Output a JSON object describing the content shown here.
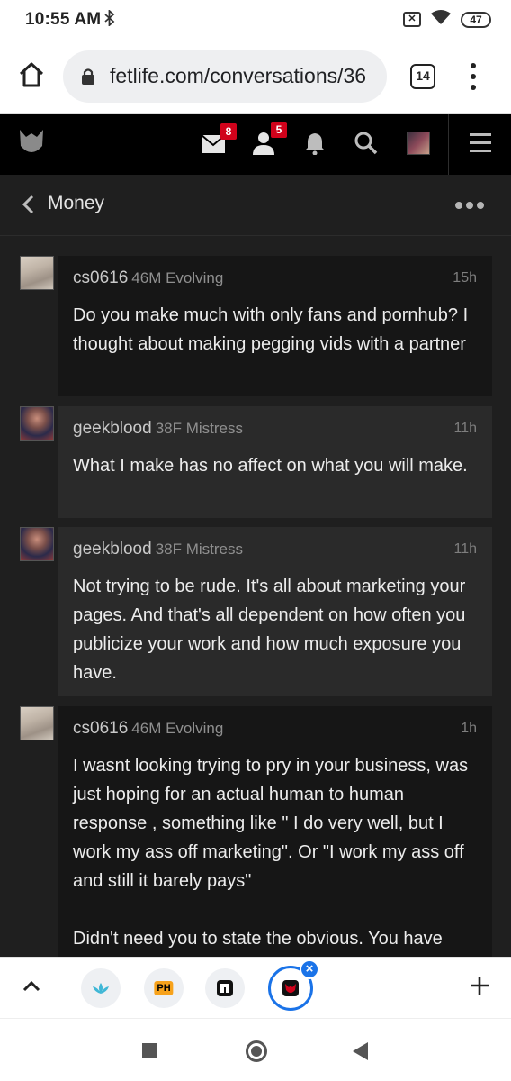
{
  "status_bar": {
    "time": "10:55 AM",
    "battery": "47"
  },
  "browser": {
    "url": "fetlife.com/conversations/36",
    "tab_count": "14"
  },
  "site_nav": {
    "mail_badge": "8",
    "friends_badge": "5"
  },
  "conversation": {
    "title": "Money",
    "messages": [
      {
        "username": "cs0616",
        "info": "46M Evolving",
        "time": "15h",
        "text": "Do you make much with only fans and pornhub? I thought about making pegging vids with a partner"
      },
      {
        "username": "geekblood",
        "info": "38F Mistress",
        "time": "11h",
        "text": "What I make has no affect on what you will make."
      },
      {
        "username": "geekblood",
        "info": "38F Mistress",
        "time": "11h",
        "text": "Not trying to be rude. It's all about marketing your pages. And that's all dependent on how often you publicize your work and how much exposure you have."
      },
      {
        "username": "cs0616",
        "info": "46M Evolving",
        "time": "1h",
        "text": "I wasnt looking trying to pry in your business, was just hoping for an actual human to human response , something like \" I do very well, but I work my ass off marketing\". Or \"I work my ass off and still it barely pays\"\n\nDidn't need you to state the obvious. You have"
      }
    ]
  },
  "tab_strip": {
    "tab2_label": "PH"
  },
  "colors": {
    "badge": "#d0021b",
    "chrome_accent": "#1a73e8"
  }
}
